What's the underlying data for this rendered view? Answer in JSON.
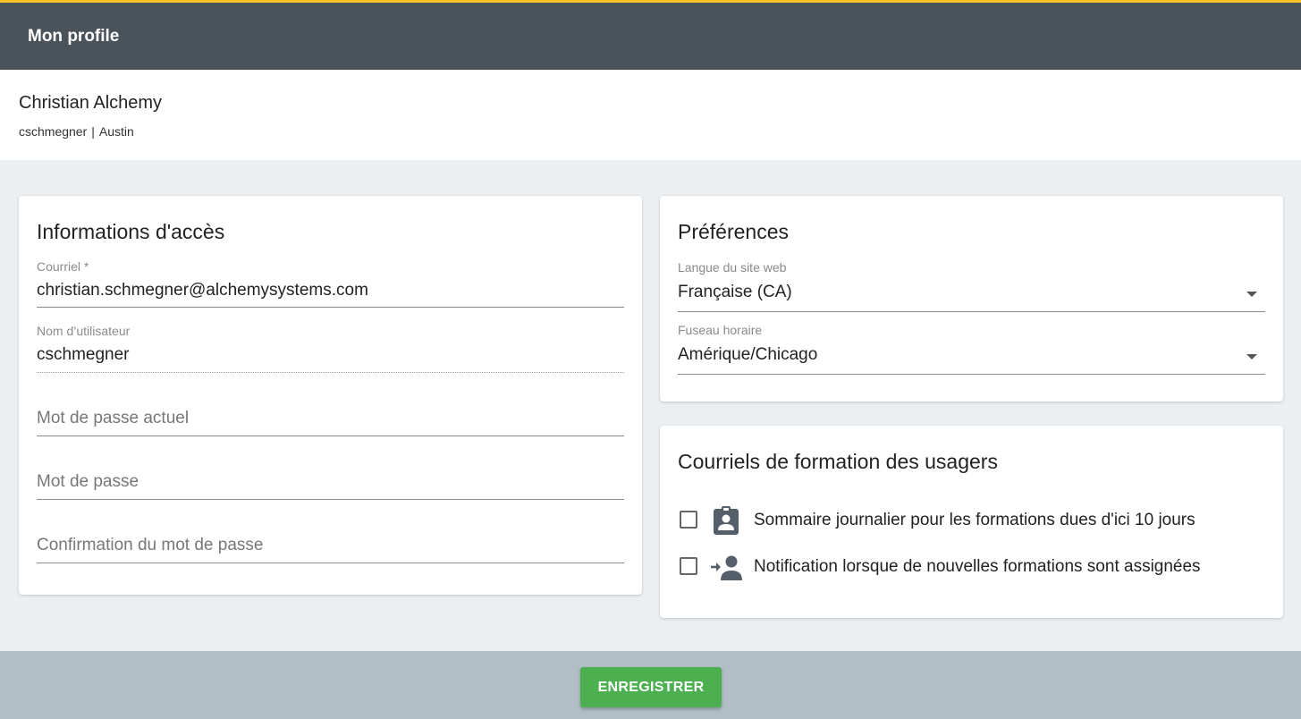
{
  "header": {
    "title": "Mon profile",
    "accent_color": "#f6c324",
    "bar_color": "#4a525a"
  },
  "user": {
    "name": "Christian Alchemy",
    "username": "cschmegner",
    "separator": "|",
    "location": "Austin"
  },
  "access": {
    "title": "Informations d'accès",
    "email_label": "Courriel *",
    "email_value": "christian.schmegner@alchemysystems.com",
    "username_label": "Nom d’utilisateur",
    "username_value": "cschmegner",
    "current_password_placeholder": "Mot de passe actuel",
    "password_placeholder": "Mot de passe",
    "confirm_password_placeholder": "Confirmation du mot de passe"
  },
  "preferences": {
    "title": "Préférences",
    "language_label": "Langue du site web",
    "language_value": "Française (CA)",
    "timezone_label": "Fuseau horaire",
    "timezone_value": "Amérique/Chicago"
  },
  "emails": {
    "title": "Courriels de formation des usagers",
    "options": [
      {
        "label": "Sommaire journalier pour les formations dues d'ici 10 jours",
        "checked": false,
        "icon": "clipboard-account-icon"
      },
      {
        "label": "Notification lorsque de nouvelles formations sont assignées",
        "checked": false,
        "icon": "person-assign-icon"
      }
    ]
  },
  "footer": {
    "save_label": "ENREGISTRER",
    "button_color": "#4caf50"
  }
}
